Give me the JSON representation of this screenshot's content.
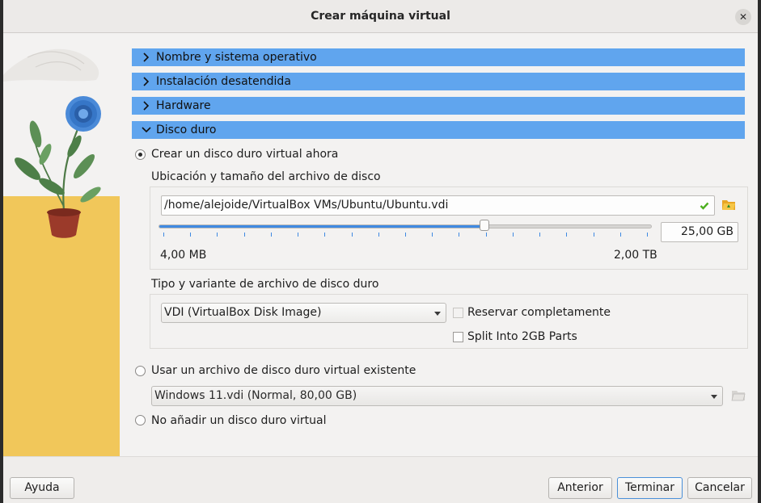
{
  "window": {
    "title": "Crear máquina virtual"
  },
  "sections": [
    {
      "label": "Nombre y sistema operativo",
      "expanded": false
    },
    {
      "label": "Instalación desatendida",
      "expanded": false
    },
    {
      "label": "Hardware",
      "expanded": false
    },
    {
      "label": "Disco duro",
      "expanded": true
    }
  ],
  "disk": {
    "create_option": {
      "label": "Crear un disco duro virtual ahora",
      "selected": true
    },
    "location_group_label": "Ubicación y tamaño del archivo de disco",
    "file_path": "/home/alejoide/VirtualBox VMs/Ubuntu/Ubuntu.vdi",
    "size_value": "25,00 GB",
    "size_min_label": "4,00 MB",
    "size_max_label": "2,00 TB",
    "size_slider_fraction": 0.66,
    "type_group_label": "Tipo y variante de archivo de disco duro",
    "type_selected": "VDI (VirtualBox Disk Image)",
    "preallocate": {
      "label": "Reservar completamente",
      "checked": false,
      "enabled": false
    },
    "split": {
      "label": "Split Into 2GB Parts",
      "checked": false,
      "enabled": true
    },
    "existing_option": {
      "label": "Usar un archivo de disco duro virtual existente",
      "selected": false
    },
    "existing_selected": "Windows 11.vdi (Normal, 80,00 GB)",
    "none_option": {
      "label": "No añadir un disco duro virtual",
      "selected": false
    }
  },
  "buttons": {
    "help": "Ayuda",
    "back": "Anterior",
    "finish": "Terminar",
    "cancel": "Cancelar"
  },
  "colors": {
    "section_header": "#60a5ee",
    "accent": "#3f8ae2",
    "valid_check": "#4caf1e"
  },
  "icons": {
    "close": "close-icon",
    "chevron_right": "chevron-right-icon",
    "chevron_down": "chevron-down-icon",
    "valid": "checkmark-icon",
    "folder": "folder-open-icon"
  }
}
